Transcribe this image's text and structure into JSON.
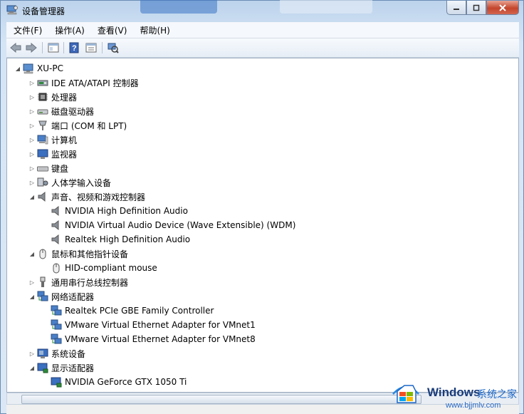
{
  "window": {
    "title": "设备管理器"
  },
  "menu": [
    {
      "label": "文件(F)"
    },
    {
      "label": "操作(A)"
    },
    {
      "label": "查看(V)"
    },
    {
      "label": "帮助(H)"
    }
  ],
  "tree": {
    "root": "XU-PC",
    "items": [
      {
        "label": "IDE ATA/ATAPI 控制器",
        "icon": "ide-controller-icon",
        "level": 1,
        "state": "collapsed"
      },
      {
        "label": "处理器",
        "icon": "processor-icon",
        "level": 1,
        "state": "collapsed"
      },
      {
        "label": "磁盘驱动器",
        "icon": "disk-drive-icon",
        "level": 1,
        "state": "collapsed"
      },
      {
        "label": "端口 (COM 和 LPT)",
        "icon": "port-icon",
        "level": 1,
        "state": "collapsed"
      },
      {
        "label": "计算机",
        "icon": "computer-icon",
        "level": 1,
        "state": "collapsed"
      },
      {
        "label": "监视器",
        "icon": "monitor-icon",
        "level": 1,
        "state": "collapsed"
      },
      {
        "label": "键盘",
        "icon": "keyboard-icon",
        "level": 1,
        "state": "collapsed"
      },
      {
        "label": "人体学输入设备",
        "icon": "hid-icon",
        "level": 1,
        "state": "collapsed"
      },
      {
        "label": "声音、视频和游戏控制器",
        "icon": "speaker-icon",
        "level": 1,
        "state": "expanded"
      },
      {
        "label": "NVIDIA High Definition Audio",
        "icon": "speaker-icon",
        "level": 2
      },
      {
        "label": "NVIDIA Virtual Audio Device (Wave Extensible) (WDM)",
        "icon": "speaker-icon",
        "level": 2
      },
      {
        "label": "Realtek High Definition Audio",
        "icon": "speaker-icon",
        "level": 2
      },
      {
        "label": "鼠标和其他指针设备",
        "icon": "mouse-icon",
        "level": 1,
        "state": "expanded"
      },
      {
        "label": "HID-compliant mouse",
        "icon": "mouse-icon",
        "level": 2
      },
      {
        "label": "通用串行总线控制器",
        "icon": "usb-icon",
        "level": 1,
        "state": "collapsed"
      },
      {
        "label": "网络适配器",
        "icon": "network-adapter-icon",
        "level": 1,
        "state": "expanded"
      },
      {
        "label": "Realtek PCIe GBE Family Controller",
        "icon": "network-adapter-icon",
        "level": 2
      },
      {
        "label": "VMware Virtual Ethernet Adapter for VMnet1",
        "icon": "network-adapter-icon",
        "level": 2
      },
      {
        "label": "VMware Virtual Ethernet Adapter for VMnet8",
        "icon": "network-adapter-icon",
        "level": 2
      },
      {
        "label": "系统设备",
        "icon": "system-devices-icon",
        "level": 1,
        "state": "collapsed"
      },
      {
        "label": "显示适配器",
        "icon": "display-adapter-icon",
        "level": 1,
        "state": "expanded"
      },
      {
        "label": "NVIDIA GeForce GTX 1050 Ti",
        "icon": "display-adapter-icon",
        "level": 2
      }
    ]
  },
  "watermark": {
    "brand": "Windows",
    "site_cn": "系统之家",
    "url": "www.bjjmlv.com"
  },
  "colors": {
    "accent": "#1a66c8",
    "close": "#c4452c"
  }
}
